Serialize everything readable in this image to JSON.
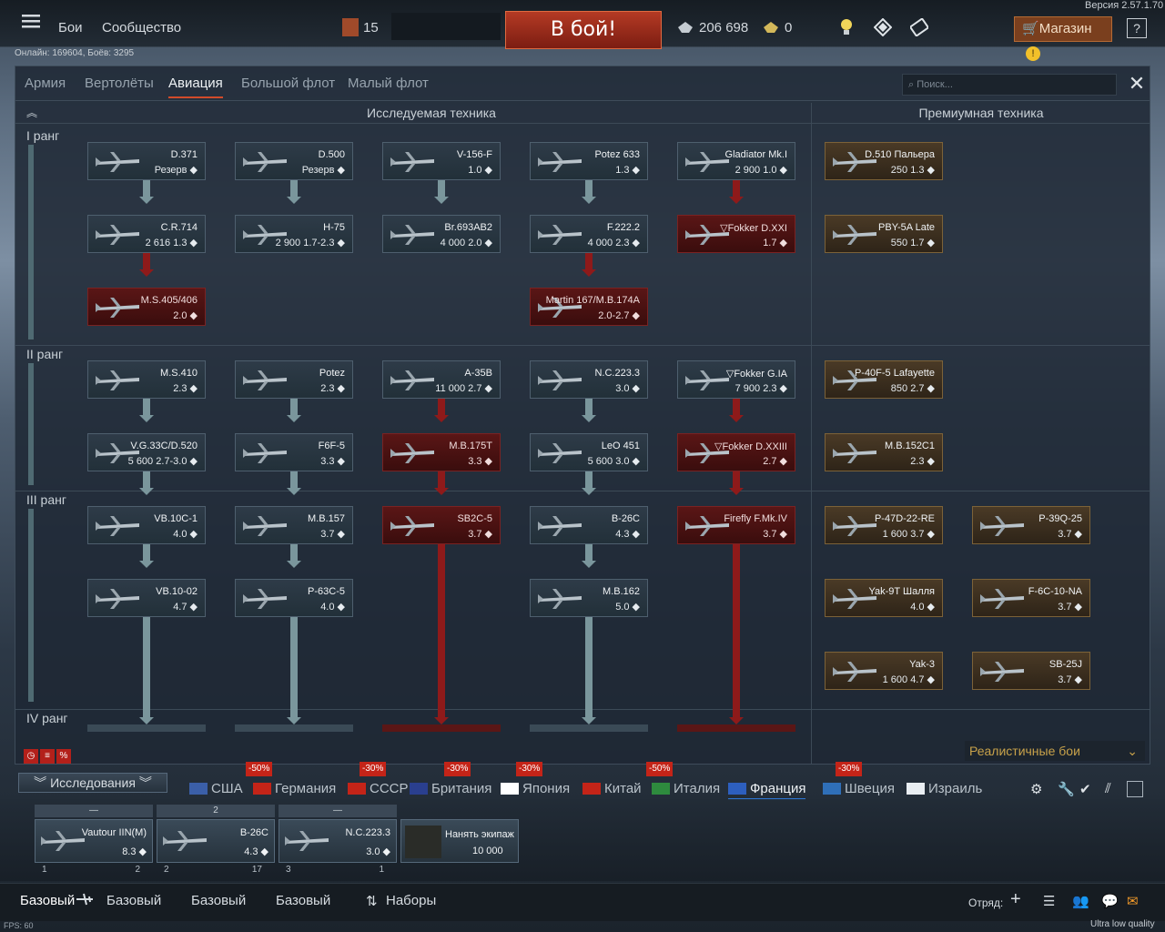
{
  "topbar": {
    "version": "Версия 2.57.1.70",
    "menu": [
      "Бои",
      "Сообщество"
    ],
    "level": "15",
    "battle": "В бой!",
    "silver": "206 698",
    "gold": "0",
    "shop": "Магазин",
    "help": "?"
  },
  "status": {
    "online": "Онлайн: 169604, Боёв: 3295"
  },
  "tabs": [
    "Армия",
    "Вертолёты",
    "Авиация",
    "Большой флот",
    "Малый флот"
  ],
  "search": {
    "placeholder": "Поиск..."
  },
  "headers": {
    "research": "Исследуемая техника",
    "premium": "Премиумная техника"
  },
  "ranks": [
    "I ранг",
    "II ранг",
    "III ранг",
    "IV ранг"
  ],
  "vehicles": {
    "c0r0": {
      "name": "D.371",
      "sub": "Резерв ◆"
    },
    "c0r1": {
      "name": "C.R.714",
      "sub": "2 616 1.3 ◆"
    },
    "c0r2": {
      "name": "M.S.405/406",
      "sub": "2.0 ◆"
    },
    "c1r0": {
      "name": "D.500",
      "sub": "Резерв ◆"
    },
    "c1r1": {
      "name": "H-75",
      "sub": "2 900 1.7-2.3 ◆"
    },
    "c2r0": {
      "name": "V-156-F",
      "sub": "1.0 ◆"
    },
    "c2r1": {
      "name": "Br.693AB2",
      "sub": "4 000 2.0 ◆"
    },
    "c3r0": {
      "name": "Potez 633",
      "sub": "1.3 ◆"
    },
    "c3r1": {
      "name": "F.222.2",
      "sub": "4 000 2.3 ◆"
    },
    "c3r2": {
      "name": "Martin 167/M.B.174A",
      "sub": "2.0-2.7 ◆"
    },
    "c4r0": {
      "name": "Gladiator Mk.I",
      "sub": "2 900 1.0 ◆"
    },
    "c4r1": {
      "name": "▽Fokker D.XXI",
      "sub": "1.7 ◆"
    },
    "p0r0": {
      "name": "D.510 Пальера",
      "sub": "250 1.3 ◆"
    },
    "p0r1": {
      "name": "PBY-5A Late",
      "sub": "550 1.7 ◆"
    },
    "c0r3": {
      "name": "M.S.410",
      "sub": "2.3 ◆"
    },
    "c0r4": {
      "name": "V.G.33C/D.520",
      "sub": "5 600 2.7-3.0 ◆"
    },
    "c1r3": {
      "name": "Potez",
      "sub": "2.3 ◆"
    },
    "c1r4": {
      "name": "F6F-5",
      "sub": "3.3 ◆"
    },
    "c2r3": {
      "name": "A-35B",
      "sub": "11 000 2.7 ◆"
    },
    "c2r4": {
      "name": "M.B.175T",
      "sub": "3.3 ◆"
    },
    "c3r3": {
      "name": "N.C.223.3",
      "sub": "3.0 ◆"
    },
    "c3r4": {
      "name": "LeO 451",
      "sub": "5 600 3.0 ◆"
    },
    "c4r3": {
      "name": "▽Fokker G.IA",
      "sub": "7 900 2.3 ◆"
    },
    "c4r4": {
      "name": "▽Fokker D.XXIII",
      "sub": "2.7 ◆"
    },
    "p0r3": {
      "name": "P-40F-5 Lafayette",
      "sub": "850 2.7 ◆"
    },
    "p0r4": {
      "name": "M.B.152C1",
      "sub": "2.3 ◆"
    },
    "c0r5": {
      "name": "VB.10C-1",
      "sub": "4.0 ◆"
    },
    "c0r6": {
      "name": "VB.10-02",
      "sub": "4.7 ◆"
    },
    "c1r5": {
      "name": "M.B.157",
      "sub": "3.7 ◆"
    },
    "c1r6": {
      "name": "P-63C-5",
      "sub": "4.0 ◆"
    },
    "c2r5": {
      "name": "SB2C-5",
      "sub": "3.7 ◆"
    },
    "c3r5": {
      "name": "B-26C",
      "sub": "4.3 ◆"
    },
    "c3r6": {
      "name": "M.B.162",
      "sub": "5.0 ◆"
    },
    "c4r5": {
      "name": "Firefly F.Mk.IV",
      "sub": "3.7 ◆"
    },
    "p0r5": {
      "name": "P-47D-22-RE",
      "sub": "1 600 3.7 ◆"
    },
    "p1r5": {
      "name": "P-39Q-25",
      "sub": "3.7 ◆"
    },
    "p0r6": {
      "name": "Yak-9T Шалля",
      "sub": "4.0 ◆"
    },
    "p1r6": {
      "name": "F-6C-10-NA",
      "sub": "3.7 ◆"
    },
    "p0r7": {
      "name": "Yak-3",
      "sub": "1 600 4.7 ◆"
    },
    "p1r7": {
      "name": "SB-25J",
      "sub": "3.7 ◆"
    }
  },
  "mode": "Реалистичные бои",
  "research_btn": "Исследования",
  "sales": [
    "-50%",
    "-30%",
    "-30%",
    "-30%",
    "-50%",
    "-30%"
  ],
  "nations": [
    "США",
    "Германия",
    "СССР",
    "Британия",
    "Япония",
    "Китай",
    "Италия",
    "Франция",
    "Швеция",
    "Израиль"
  ],
  "crew": [
    {
      "head": "—",
      "name": "Vautour IIN(M)",
      "br": "8.3 ◆",
      "left": "1",
      "right": "2"
    },
    {
      "head": "2",
      "name": "B-26C",
      "br": "4.3 ◆",
      "left": "2",
      "right": "17"
    },
    {
      "head": "—",
      "name": "N.C.223.3",
      "br": "3.0 ◆",
      "left": "3",
      "right": "1"
    }
  ],
  "hire": {
    "label": "Нанять экипаж",
    "price": "10 000"
  },
  "bottom_tabs": [
    "Базовый",
    "Базовый",
    "Базовый",
    "Базовый",
    "Наборы"
  ],
  "squad": "Отряд:",
  "fps": "FPS: 60",
  "quality": "Ultra low quality"
}
